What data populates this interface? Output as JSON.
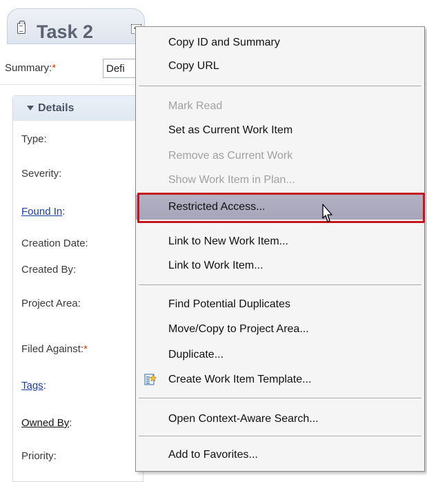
{
  "editor": {
    "title": "Task 2",
    "summary_label": "Summary:",
    "required_mark": "*",
    "summary_value": "Defi",
    "details_title": "Details",
    "fields": [
      {
        "label": "Type:",
        "link": false,
        "required": false
      },
      {
        "label": "Severity:",
        "link": false,
        "required": false
      },
      {
        "label": "Found In",
        "suffix": ":",
        "link": true,
        "required": false
      },
      {
        "label": "Creation Date:",
        "link": false,
        "required": false
      },
      {
        "label": "Created By:",
        "link": false,
        "required": false
      },
      {
        "label": "Project Area:",
        "link": false,
        "required": false
      },
      {
        "label": "Filed Against:",
        "link": false,
        "required": true
      },
      {
        "label": "Tags",
        "suffix": ":",
        "link": true,
        "required": false
      },
      {
        "label": "Owned By",
        "suffix": ":",
        "link": true,
        "required": false
      },
      {
        "label": "Priority:",
        "link": false,
        "required": false
      }
    ]
  },
  "menu": {
    "items": [
      {
        "label": "Copy ID and Summary",
        "disabled": false
      },
      {
        "label": "Copy URL",
        "disabled": false
      },
      {
        "label": "Mark Read",
        "disabled": true
      },
      {
        "label": "Set as Current Work Item",
        "disabled": false
      },
      {
        "label": "Remove as Current Work",
        "disabled": true
      },
      {
        "label": "Show Work Item in Plan...",
        "disabled": true
      },
      {
        "label": "Restricted Access...",
        "disabled": false,
        "hover": true
      },
      {
        "label": "Link to New Work Item...",
        "disabled": false
      },
      {
        "label": "Link to Work Item...",
        "disabled": false
      },
      {
        "label": "Find Potential Duplicates",
        "disabled": false
      },
      {
        "label": "Move/Copy to Project Area...",
        "disabled": false
      },
      {
        "label": "Duplicate...",
        "disabled": false
      },
      {
        "label": "Create Work Item Template...",
        "disabled": false,
        "icon": "template-icon"
      },
      {
        "label": "Open Context-Aware Search...",
        "disabled": false
      },
      {
        "label": "Add to Favorites...",
        "disabled": false
      }
    ]
  },
  "colors": {
    "highlight_border": "#c4161c",
    "hover_background": "#aeacc0",
    "disabled_text": "#a0a0a0",
    "link_text": "#1a3ea8"
  }
}
